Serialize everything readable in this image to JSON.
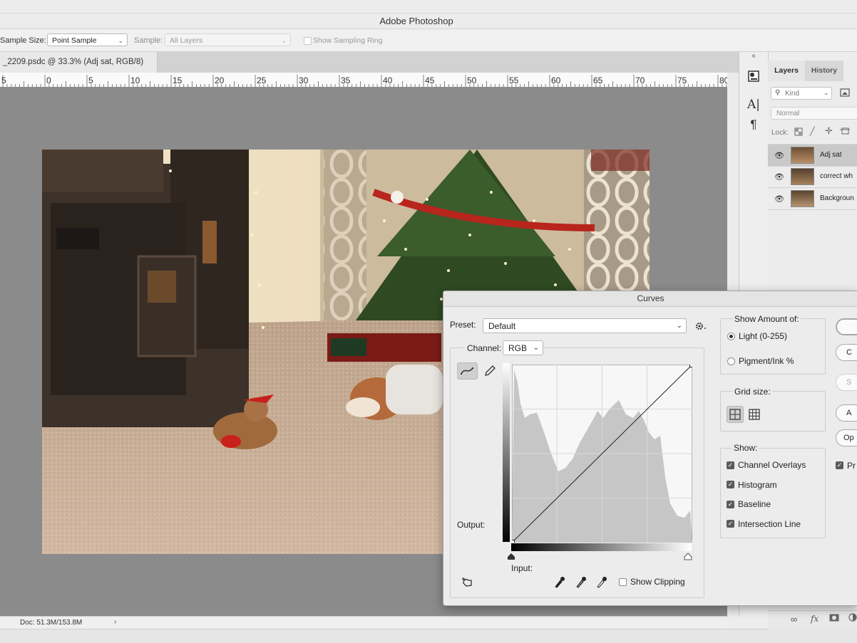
{
  "app": {
    "title": "Adobe Photoshop"
  },
  "options_bar": {
    "sample_size_label": "Sample Size:",
    "sample_size_value": "Point Sample",
    "sample_label": "Sample:",
    "sample_value": "All Layers",
    "show_sampling_ring": "Show Sampling Ring",
    "show_sampling_ring_checked": false
  },
  "document": {
    "tab_title": "_2209.psdc @ 33.3% (Adj sat, RGB/8)",
    "zoom_percent": 33.3,
    "doc_size": "Doc: 51.3M/153.8M",
    "status_arrow": "›"
  },
  "ruler": {
    "labels": [
      "5",
      "0",
      "5",
      "10",
      "15",
      "20",
      "25",
      "30",
      "35",
      "40",
      "45",
      "50",
      "55",
      "60",
      "65",
      "70",
      "75",
      "80"
    ]
  },
  "panel_tabs": {
    "layers": "Layers",
    "history": "History"
  },
  "layers_panel": {
    "filter_kind": "Kind",
    "blend_mode": "Normal",
    "lock_label": "Lock:",
    "layers": [
      {
        "name": "Adj sat",
        "visible": true,
        "selected": true
      },
      {
        "name": "correct wh",
        "visible": true,
        "selected": false
      },
      {
        "name": "Backgroun",
        "visible": true,
        "selected": false
      }
    ]
  },
  "curves": {
    "title": "Curves",
    "preset_label": "Preset:",
    "preset_value": "Default",
    "channel_label": "Channel:",
    "channel_value": "RGB",
    "output_label": "Output:",
    "input_label": "Input:",
    "show_clipping": "Show Clipping",
    "show_clipping_checked": false,
    "show_amount_title": "Show Amount of:",
    "light_option": "Light  (0-255)",
    "pigment_option": "Pigment/Ink %",
    "selected_amount": "light",
    "grid_size_title": "Grid size:",
    "show_title": "Show:",
    "show_options": [
      {
        "label": "Channel Overlays",
        "checked": true
      },
      {
        "label": "Histogram",
        "checked": true
      },
      {
        "label": "Baseline",
        "checked": true
      },
      {
        "label": "Intersection Line",
        "checked": true
      }
    ],
    "buttons": {
      "cancel_partial": "C",
      "smooth_partial": "S",
      "auto_partial": "A",
      "options_partial": "Op",
      "preview_partial": "Pr"
    },
    "preview_checked": true,
    "curve_points": [
      [
        0,
        0
      ],
      [
        255,
        255
      ]
    ],
    "colors": {
      "histogram": "#c6c6c6",
      "graph_bg": "#f7f7f7"
    }
  },
  "icons": [
    "settings-gear-icon",
    "curve-points-icon",
    "pencil-icon",
    "hand-adjust-icon",
    "black-eyedropper-icon",
    "gray-eyedropper-icon",
    "white-eyedropper-icon",
    "eye-icon",
    "link-icon",
    "fx-icon",
    "mask-icon",
    "adjustment-icon"
  ]
}
